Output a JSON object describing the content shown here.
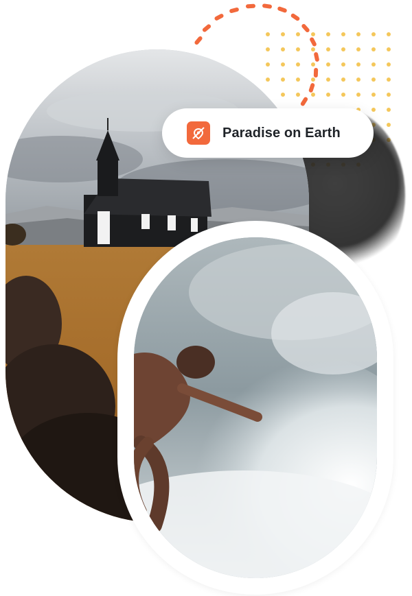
{
  "location_badge": {
    "label": "Paradise on Earth",
    "icon": "map-pin-icon",
    "icon_color": "#f2693c"
  },
  "images": [
    {
      "name": "church-photo",
      "subject": "church-landscape"
    },
    {
      "name": "surfer-photo",
      "subject": "surfer-wave"
    }
  ],
  "colors": {
    "accent": "#f2693c",
    "dots_yellow": "#f3c24a",
    "dark_blob": "#1f1f1f",
    "text_dark": "#1f2328",
    "frame": "#ffffff"
  }
}
